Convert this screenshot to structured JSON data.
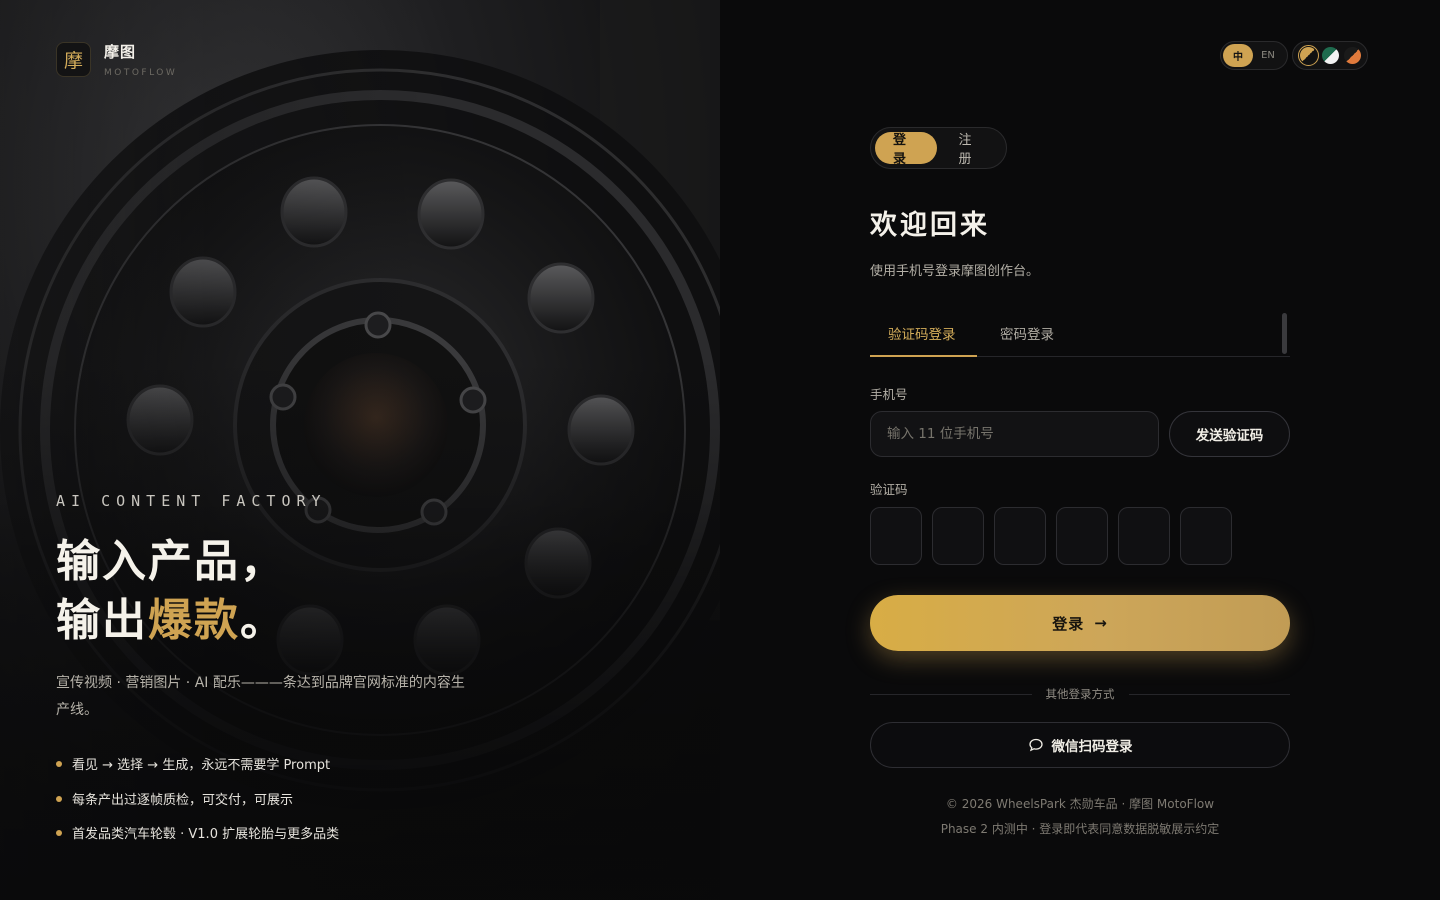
{
  "brand": {
    "mark": "摩",
    "name": "摩图",
    "sub": "MOTOFLOW"
  },
  "hero": {
    "kicker": "AI CONTENT FACTORY",
    "headline_line1": "输入产品，",
    "headline_line2_prefix": "输出",
    "headline_line2_gold": "爆款",
    "headline_line2_suffix": "。",
    "lede": "宣传视频 · 营销图片 · AI 配乐———条达到品牌官网标准的内容生产线。",
    "bullets": [
      "看见 → 选择 → 生成，永远不需要学 Prompt",
      "每条产出过逐帧质检，可交付，可展示",
      "首发品类汽车轮毂 · V1.0 扩展轮胎与更多品类"
    ]
  },
  "lang_switch": {
    "zh": "中",
    "en": "EN",
    "active": "zh"
  },
  "theme_switch": {
    "swatches": [
      {
        "icon": "theme-dark-gold-icon",
        "color_a": "#cfa352",
        "color_b": "#111111"
      },
      {
        "icon": "theme-green-white-icon",
        "color_a": "#1e6b4e",
        "color_b": "#f3f3f3"
      },
      {
        "icon": "theme-orange-dark-icon",
        "color_a": "#e07a3c",
        "color_b": "#1a1a1a"
      }
    ]
  },
  "mode_switch": {
    "login": "登录",
    "register": "注册",
    "active": "login"
  },
  "form": {
    "title": "欢迎回来",
    "subtitle": "使用手机号登录摩图创作台。",
    "tabs": {
      "sms": "验证码登录",
      "password": "密码登录",
      "active": "sms"
    },
    "phone_label": "手机号",
    "phone_placeholder": "输入 11 位手机号",
    "phone_value": "",
    "send_code": "发送验证码",
    "code_label": "验证码",
    "code_digits": [
      "",
      "",
      "",
      "",
      "",
      ""
    ],
    "submit": "登录",
    "submit_arrow": "→",
    "divider": "其他登录方式",
    "wechat": "微信扫码登录"
  },
  "footer": {
    "line1": "© 2026 WheelsPark 杰勋车品 · 摩图 MotoFlow",
    "line2": "Phase 2 内测中 · 登录即代表同意数据脱敏展示约定"
  },
  "colors": {
    "accent": "#cfa352",
    "panel_bg": "#0a0a0b",
    "text": "#f4f1ea"
  }
}
